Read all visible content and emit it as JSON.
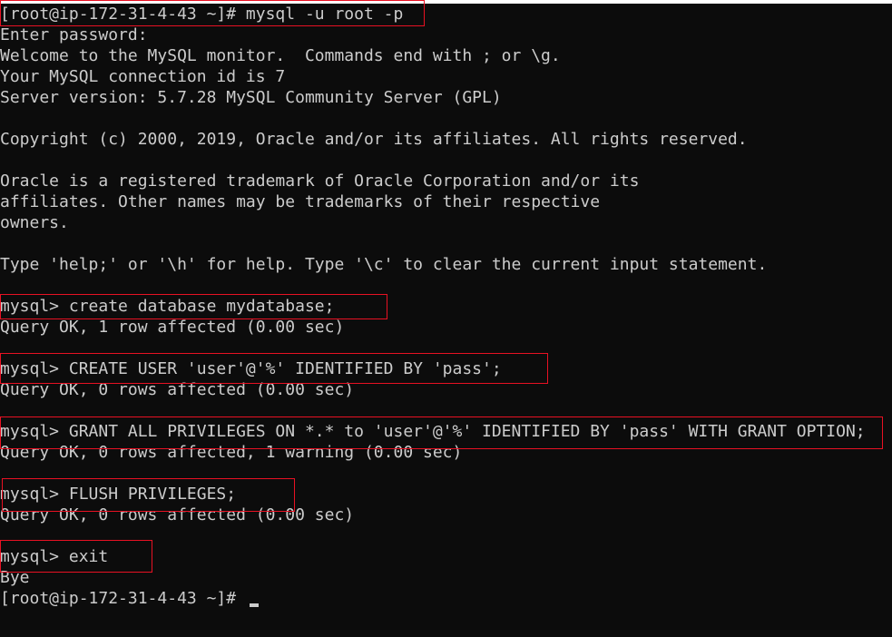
{
  "terminal": {
    "lines": [
      "[root@ip-172-31-4-43 ~]# mysql -u root -p",
      "Enter password:",
      "Welcome to the MySQL monitor.  Commands end with ; or \\g.",
      "Your MySQL connection id is 7",
      "Server version: 5.7.28 MySQL Community Server (GPL)",
      "",
      "Copyright (c) 2000, 2019, Oracle and/or its affiliates. All rights reserved.",
      "",
      "Oracle is a registered trademark of Oracle Corporation and/or its",
      "affiliates. Other names may be trademarks of their respective",
      "owners.",
      "",
      "Type 'help;' or '\\h' for help. Type '\\c' to clear the current input statement.",
      "",
      "mysql> create database mydatabase;",
      "Query OK, 1 row affected (0.00 sec)",
      "",
      "mysql> CREATE USER 'user'@'%' IDENTIFIED BY 'pass';",
      "Query OK, 0 rows affected (0.00 sec)",
      "",
      "mysql> GRANT ALL PRIVILEGES ON *.* to 'user'@'%' IDENTIFIED BY 'pass' WITH GRANT OPTION;",
      "Query OK, 0 rows affected, 1 warning (0.00 sec)",
      "",
      "mysql> FLUSH PRIVILEGES;",
      "Query OK, 0 rows affected (0.00 sec)",
      "",
      "mysql> exit",
      "Bye",
      "[root@ip-172-31-4-43 ~]# "
    ],
    "colors": {
      "background": "#0c0c0c",
      "foreground": "#cccccc",
      "highlight_box": "#e81123"
    },
    "cursor": "block-underline"
  }
}
